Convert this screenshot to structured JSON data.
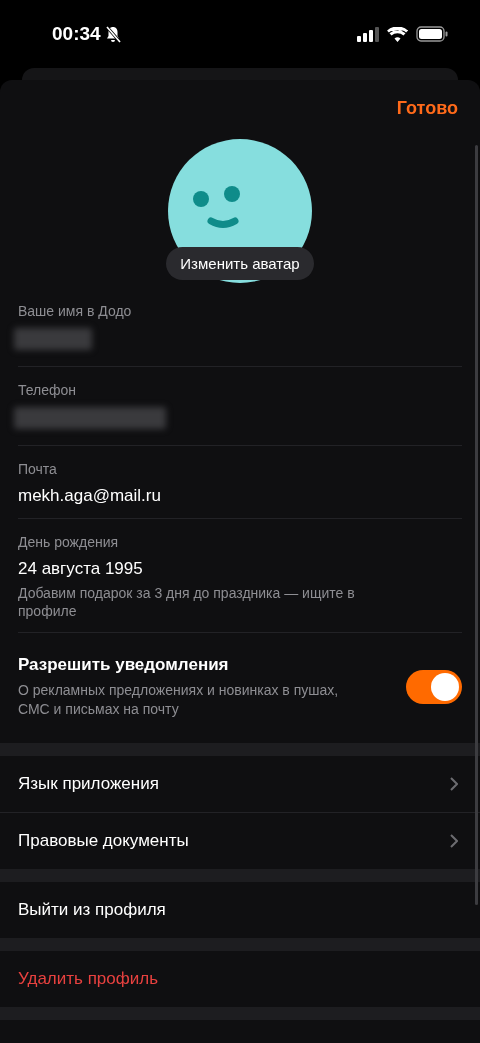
{
  "status_bar": {
    "time": "00:34"
  },
  "header": {
    "done": "Готово"
  },
  "avatar": {
    "button": "Изменить аватар"
  },
  "fields": [
    {
      "label": "Ваше имя в Додо",
      "kind": "redacted"
    },
    {
      "label": "Телефон",
      "kind": "redacted"
    },
    {
      "label": "Почта",
      "kind": "text",
      "value": "mekh.aga@mail.ru"
    },
    {
      "label": "День рождения",
      "kind": "text",
      "value": "24 августа 1995",
      "hint": "Добавим подарок за 3 дня до праздника — ищите в профиле"
    }
  ],
  "notifications": {
    "title": "Разрешить уведомления",
    "description": "О рекламных предложениях и новинках в пушах, СМС и письмах на почту",
    "on": true
  },
  "sections": [
    [
      {
        "label": "Язык приложения",
        "kind": "link"
      },
      {
        "label": "Правовые документы",
        "kind": "link"
      }
    ],
    [
      {
        "label": "Выйти из профиля",
        "kind": "action"
      }
    ],
    [
      {
        "label": "Удалить профиль",
        "kind": "danger"
      }
    ]
  ]
}
